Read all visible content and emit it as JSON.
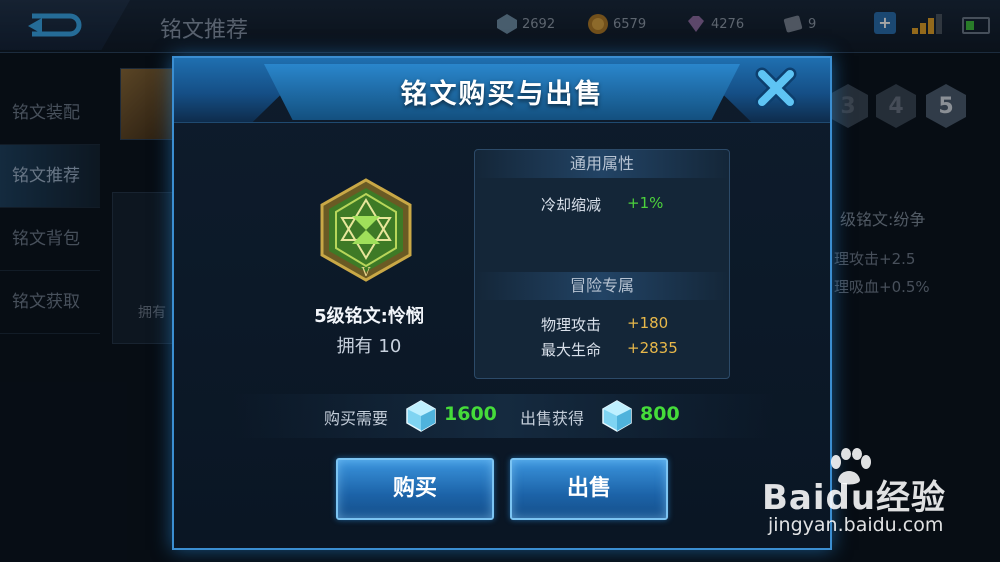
{
  "background": {
    "page_title": "铭文推荐",
    "resources": [
      {
        "icon": "gem-icon",
        "value": "2692"
      },
      {
        "icon": "gold-coin-icon",
        "value": "6579"
      },
      {
        "icon": "diamond-icon",
        "value": "4276"
      },
      {
        "icon": "coupon-icon",
        "value": "9"
      }
    ],
    "side_nav": [
      "铭文装配",
      "铭文推荐",
      "铭文背包",
      "铭文获取"
    ],
    "active_nav": "铭文推荐",
    "levels": [
      "3",
      "4",
      "5"
    ],
    "owned_partial": "拥有",
    "rune_name_partial": "级铭文:纷争",
    "stats_partial": [
      "理攻击+2.5",
      "理吸血+0.5%"
    ]
  },
  "modal": {
    "title": "铭文购买与出售",
    "rune": {
      "name": "5级铭文:怜悯",
      "owned": "拥有 10",
      "color_accent": "#6fc03a"
    },
    "general_header": "通用属性",
    "general_attrs": [
      {
        "label": "冷却缩减",
        "value": "+1%"
      }
    ],
    "adventure_header": "冒险专属",
    "adventure_attrs": [
      {
        "label": "物理攻击",
        "value": "+180"
      },
      {
        "label": "最大生命",
        "value": "+2835"
      }
    ],
    "buy_cost_label": "购买需要",
    "buy_cost": "1600",
    "sell_gain_label": "出售获得",
    "sell_gain": "800",
    "buy_button": "购买",
    "sell_button": "出售"
  },
  "watermark": {
    "logo_text": "Baidu经验",
    "url": "jingyan.baidu.com"
  },
  "colors": {
    "accent_blue": "#3b8ed1",
    "value_green": "#4cd13c",
    "value_gold": "#e8b84a"
  }
}
